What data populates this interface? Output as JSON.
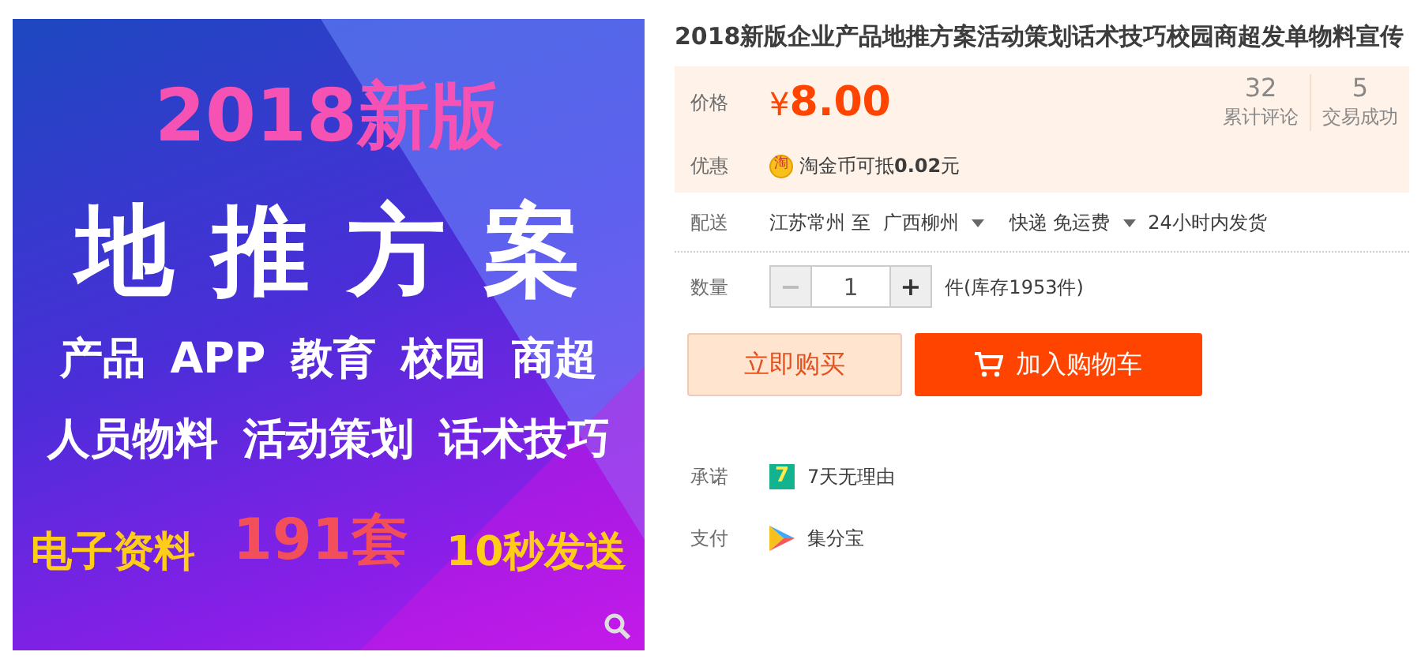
{
  "product_image": {
    "headline": "2018新版",
    "title_chars": [
      "地",
      "推",
      "方",
      "案"
    ],
    "tag_rows": [
      [
        "产品",
        "APP",
        "教育",
        "校园",
        "商超"
      ],
      [
        "人员物料",
        "活动策划",
        "话术技巧"
      ]
    ],
    "footer": [
      {
        "text": "电子资料",
        "kind": "small"
      },
      {
        "text": "191套",
        "kind": "big"
      },
      {
        "text": "10秒发送",
        "kind": "small"
      }
    ]
  },
  "title": "2018新版企业产品地推方案活动策划话术技巧校园商超发单物料宣传",
  "price": {
    "label": "价格",
    "currency": "¥",
    "amount": "8.00"
  },
  "stats": [
    {
      "value": "32",
      "label": "累计评论"
    },
    {
      "value": "5",
      "label": "交易成功"
    }
  ],
  "promo": {
    "label": "优惠",
    "badge": "淘",
    "text": "淘金币可抵**0.02**元"
  },
  "delivery": {
    "label": "配送",
    "from": "江苏常州 至",
    "to": "广西柳州",
    "method": "快递 免运费",
    "ship_time": "24小时内发货"
  },
  "quantity": {
    "label": "数量",
    "minus": "−",
    "value": "1",
    "plus": "+",
    "minus_disabled": true,
    "stock": "件(库存1953件)"
  },
  "buttons": [
    {
      "label": "立即购买",
      "kind": "buy"
    },
    {
      "label": "加入购物车",
      "kind": "cart"
    }
  ],
  "promise": {
    "label": "承诺",
    "badge": "7",
    "text": "7天无理由"
  },
  "payment": {
    "label": "支付",
    "text": "集分宝"
  }
}
